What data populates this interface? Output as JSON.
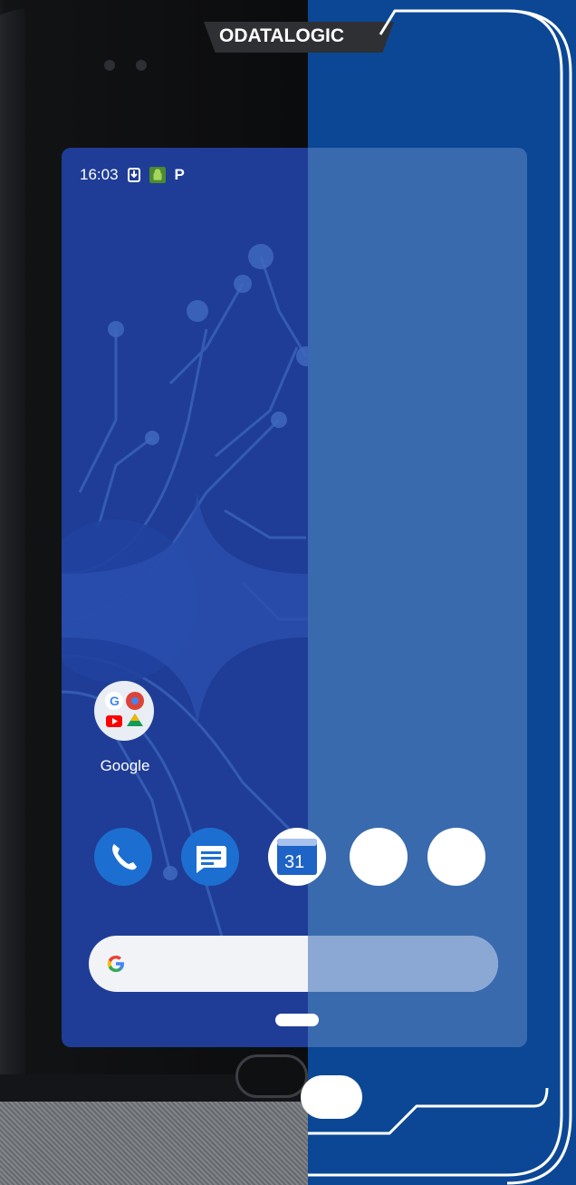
{
  "brand": {
    "logo_text": "ODATALOGIC"
  },
  "status_bar": {
    "time": "16:03",
    "icons": [
      "download-icon",
      "android-debug-icon",
      "parking-p-icon"
    ],
    "p_label": "P"
  },
  "home_screen": {
    "folder": {
      "label": "Google",
      "icons": [
        "google-g-icon",
        "chrome-icon",
        "youtube-icon",
        "drive-icon"
      ]
    },
    "dock": [
      {
        "name": "phone-app-icon"
      },
      {
        "name": "messages-app-icon"
      },
      {
        "name": "calendar-app-icon",
        "text": "31"
      },
      {
        "name": "blank-app-icon-1"
      },
      {
        "name": "blank-app-icon-2"
      }
    ],
    "search": {
      "logo_letter": "G"
    }
  },
  "colors": {
    "background_blue": "#0b4795",
    "wallpaper_blue": "#1f3d96",
    "screen_overlay": "#3a6aae",
    "search_bar": "#f1f3f7",
    "icon_blue": "#1c6fd1"
  }
}
